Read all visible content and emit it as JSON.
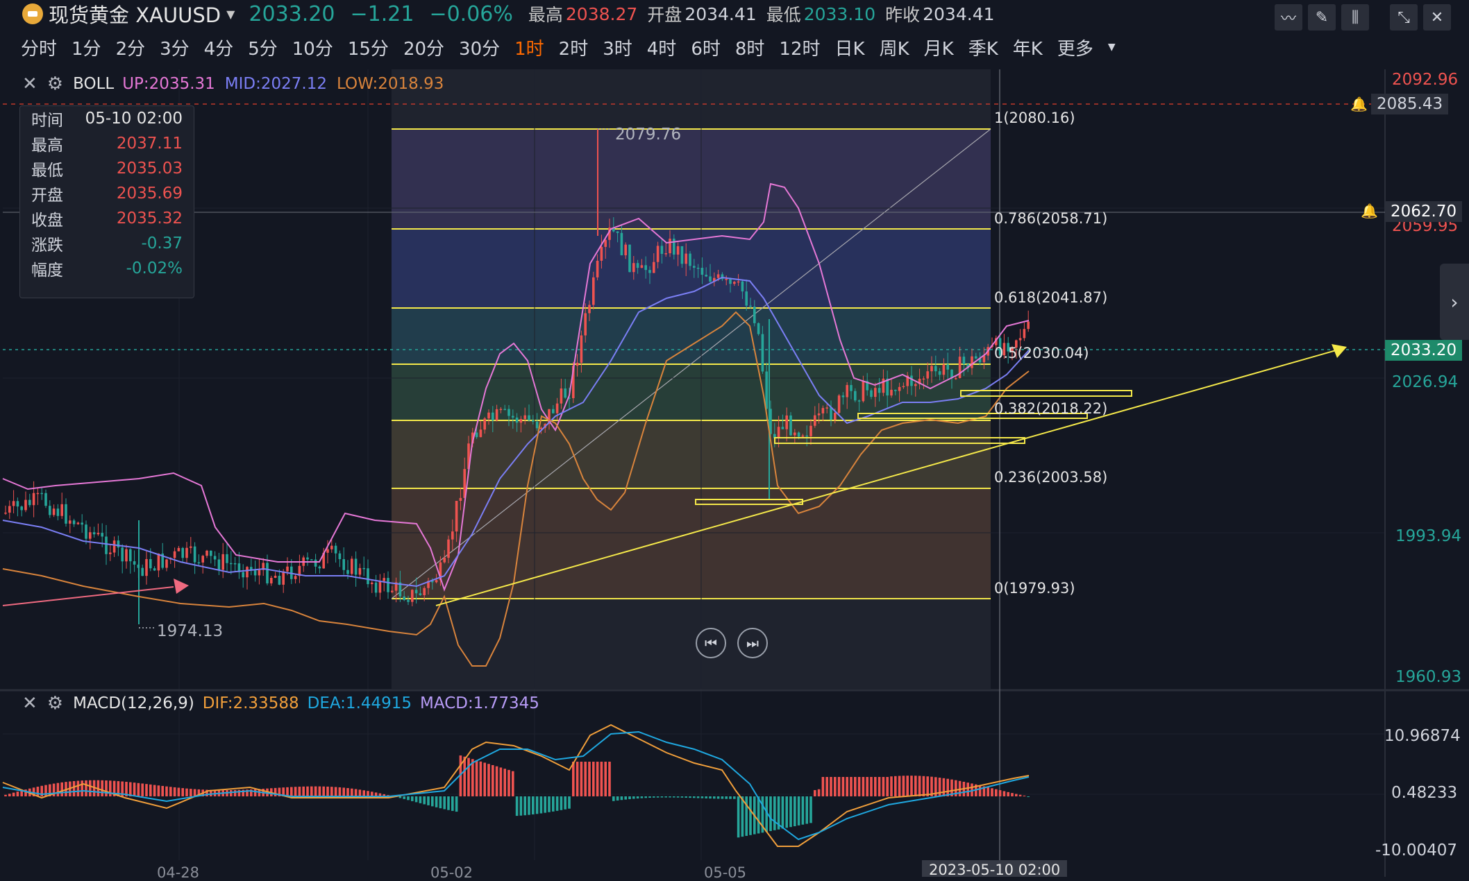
{
  "header": {
    "symbol": "现货黄金 XAUUSD",
    "price": "2033.20",
    "change": "−1.21",
    "change_pct": "−0.06%",
    "high_label": "最高",
    "high": "2038.27",
    "open_label": "开盘",
    "open": "2034.41",
    "low_label": "最低",
    "low": "2033.10",
    "prev_label": "昨收",
    "prev": "2034.41"
  },
  "timeframes": [
    "分时",
    "1分",
    "2分",
    "3分",
    "4分",
    "5分",
    "10分",
    "15分",
    "20分",
    "30分",
    "1时",
    "2时",
    "3时",
    "4时",
    "6时",
    "8时",
    "12时",
    "日K",
    "周K",
    "月K",
    "季K",
    "年K",
    "更多"
  ],
  "active_timeframe": "1时",
  "boll": {
    "name": "BOLL",
    "up": "UP:2035.31",
    "mid": "MID:2027.12",
    "low": "LOW:2018.93"
  },
  "macd": {
    "name": "MACD(12,26,9)",
    "dif": "DIF:2.33588",
    "dea": "DEA:1.44915",
    "macd": "MACD:1.77345"
  },
  "info_box": {
    "rows": [
      {
        "k": "时间",
        "v": "05-10 02:00"
      },
      {
        "k": "最高",
        "v": "2037.11"
      },
      {
        "k": "最低",
        "v": "2035.03"
      },
      {
        "k": "开盘",
        "v": "2035.69"
      },
      {
        "k": "收盘",
        "v": "2035.32"
      },
      {
        "k": "涨跌",
        "v": "-0.37"
      },
      {
        "k": "幅度",
        "v": "-0.02%"
      }
    ]
  },
  "price_axis": {
    "p1": "2092.96",
    "p2": "2085.43",
    "p3": "2062.70",
    "p4": "2059.95",
    "current": "2033.20",
    "p5": "2026.94",
    "p6": "1993.94",
    "p7": "1960.93"
  },
  "macd_axis": {
    "a1": "10.96874",
    "a2": "0.48233",
    "a3": "-10.00407"
  },
  "fib": {
    "l1": "1(2080.16)",
    "l2": "0.786(2058.71)",
    "l3": "0.618(2041.87)",
    "l4": "0.5(2030.04)",
    "l5": "0.382(2018.22)",
    "l6": "0.236(2003.58)",
    "l7": "0(1979.93)"
  },
  "annotations": {
    "high": "2079.76",
    "low": "1974.13"
  },
  "dates": {
    "d1": "04-28",
    "d2": "05-02",
    "d3": "05-05",
    "crosshair": "2023-05-10 02:00"
  },
  "colors": {
    "up": "#ef5350",
    "down": "#26a69a",
    "fib_line": "#f5e94a",
    "boll_up": "#e678d7",
    "boll_mid": "#7b7ff5",
    "boll_low": "#d9843c"
  }
}
